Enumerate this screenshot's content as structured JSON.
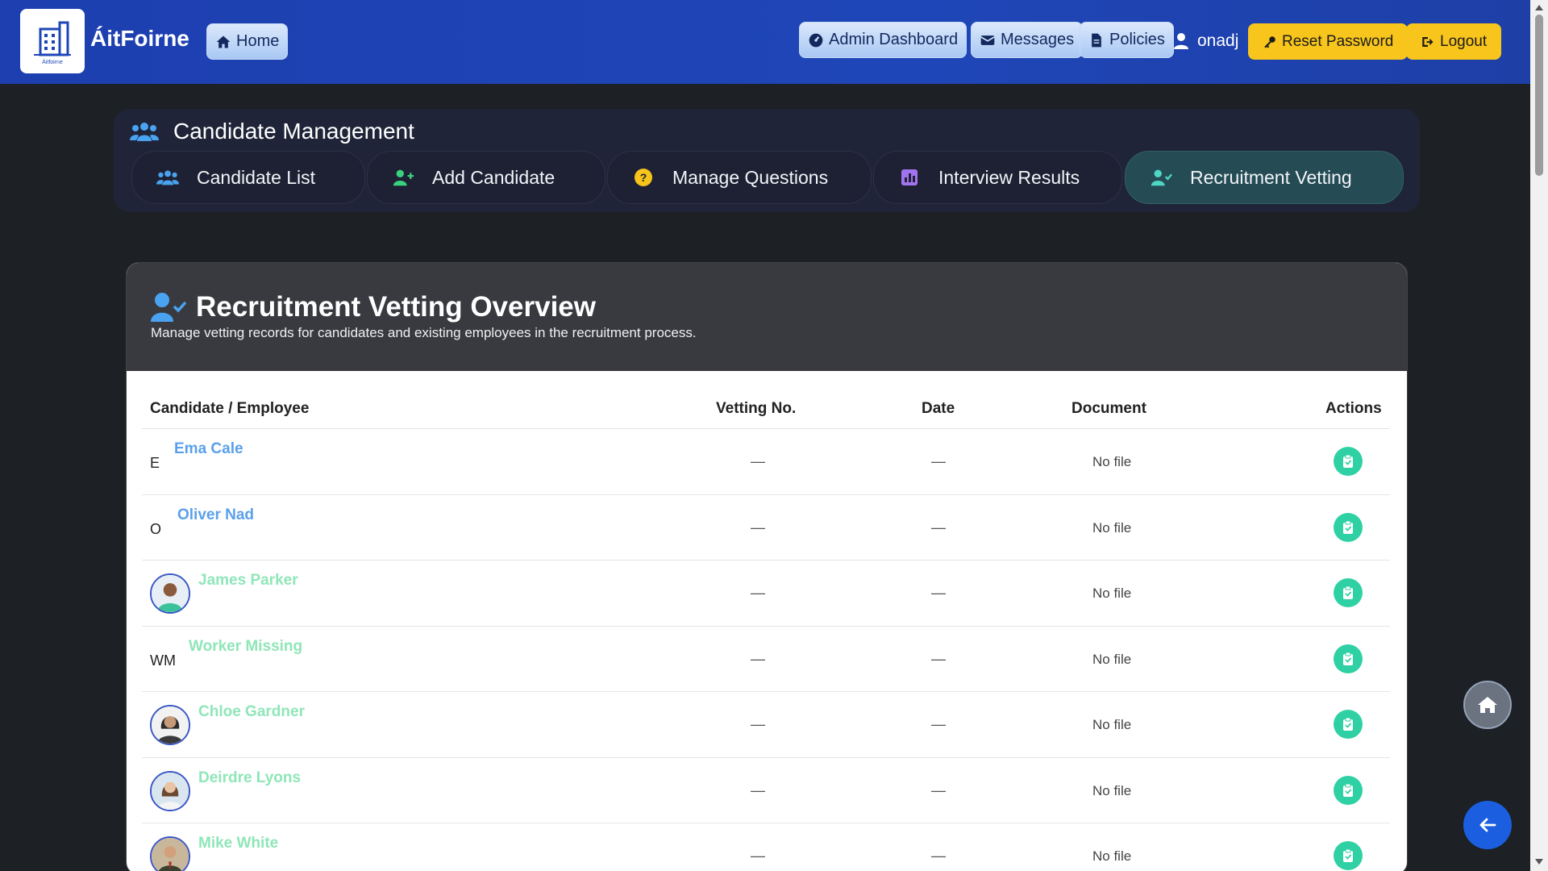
{
  "header": {
    "brand": "ÁitFoirne",
    "logo_sub": "Áitfoirne",
    "home_label": "Home",
    "admin_label": "Admin Dashboard",
    "messages_label": "Messages",
    "policies_label": "Policies",
    "username": "onadj",
    "reset_label": "Reset Password",
    "logout_label": "Logout"
  },
  "management": {
    "title": "Candidate Management",
    "tabs": [
      {
        "label": "Candidate List",
        "icon": "users-icon"
      },
      {
        "label": "Add Candidate",
        "icon": "user-plus-icon"
      },
      {
        "label": "Manage Questions",
        "icon": "question-circle-icon"
      },
      {
        "label": "Interview Results",
        "icon": "chart-square-icon"
      },
      {
        "label": "Recruitment Vetting",
        "icon": "user-check-icon",
        "active": true
      }
    ]
  },
  "overview": {
    "title": "Recruitment Vetting Overview",
    "subtitle": "Manage vetting records for candidates and existing employees in the recruitment process.",
    "columns": {
      "candidate": "Candidate / Employee",
      "vetting_no": "Vetting No.",
      "date": "Date",
      "document": "Document",
      "actions": "Actions"
    },
    "rows": [
      {
        "initials": "E",
        "name": "Ema Cale",
        "vetting_no": "—",
        "date": "—",
        "document": "No file",
        "name_color": "blue"
      },
      {
        "initials": "O",
        "name": "Oliver Nad",
        "vetting_no": "—",
        "date": "—",
        "document": "No file",
        "name_color": "blue"
      },
      {
        "avatar": true,
        "name": "James Parker",
        "vetting_no": "—",
        "date": "—",
        "document": "No file",
        "name_color": "green"
      },
      {
        "initials": "WM",
        "name": "Worker Missing",
        "vetting_no": "—",
        "date": "—",
        "document": "No file",
        "name_color": "green"
      },
      {
        "avatar": true,
        "name": "Chloe Gardner",
        "vetting_no": "—",
        "date": "—",
        "document": "No file",
        "name_color": "green"
      },
      {
        "avatar": true,
        "name": "Deirdre Lyons",
        "vetting_no": "—",
        "date": "—",
        "document": "No file",
        "name_color": "green"
      },
      {
        "avatar": true,
        "name": "Mike White",
        "vetting_no": "—",
        "date": "—",
        "document": "No file",
        "name_color": "green"
      }
    ]
  },
  "colors": {
    "header_bg": "#1f46b8",
    "accent_yellow": "#f8c51c",
    "action_green": "#2fd1a4",
    "active_tab": "#254c55"
  }
}
